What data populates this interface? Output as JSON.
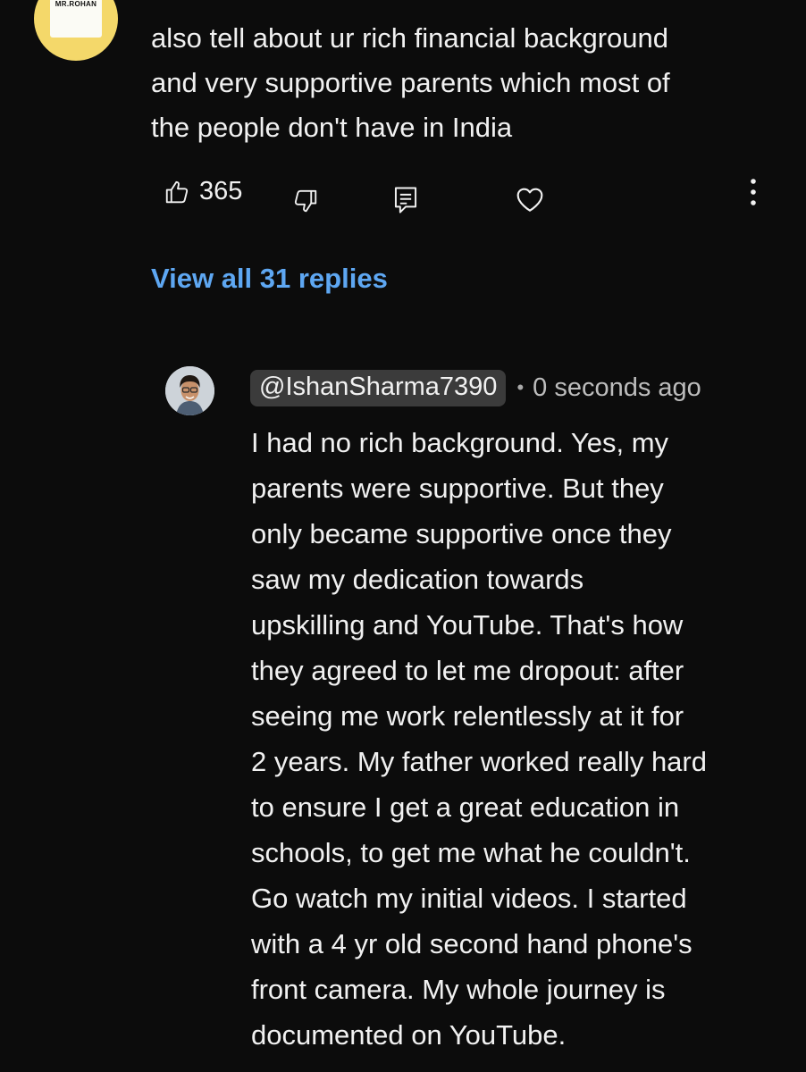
{
  "top_comment": {
    "avatar_label": "MR.ROHAN",
    "text": "also tell about ur rich financial background\nand very supportive parents which most of\nthe people don't have in India",
    "like_count": "365",
    "icons": [
      "thumbs-up-icon",
      "thumbs-down-icon",
      "reply-icon",
      "heart-icon",
      "more-options-icon"
    ]
  },
  "view_replies_label": "View all 31 replies",
  "reply": {
    "handle": "@IshanSharma7390",
    "separator": "•",
    "timestamp": "0 seconds ago",
    "text": "I had no rich background. Yes, my\nparents were supportive. But they\nonly became supportive once they\nsaw my dedication towards\nupskilling and YouTube. That's how\nthey agreed to let me dropout: after\nseeing me work relentlessly at it for\n2 years. My father worked really hard\nto ensure I get a great education in\nschools, to get me what he couldn't.\nGo watch my initial videos. I started\nwith a 4 yr old second hand phone's\nfront camera. My whole journey is\ndocumented on YouTube."
  },
  "colors": {
    "background": "#0c0c0c",
    "text": "#f1f1f1",
    "link": "#5ea7f2",
    "chip": "#3b3b3b",
    "muted": "#bdbdbd"
  }
}
